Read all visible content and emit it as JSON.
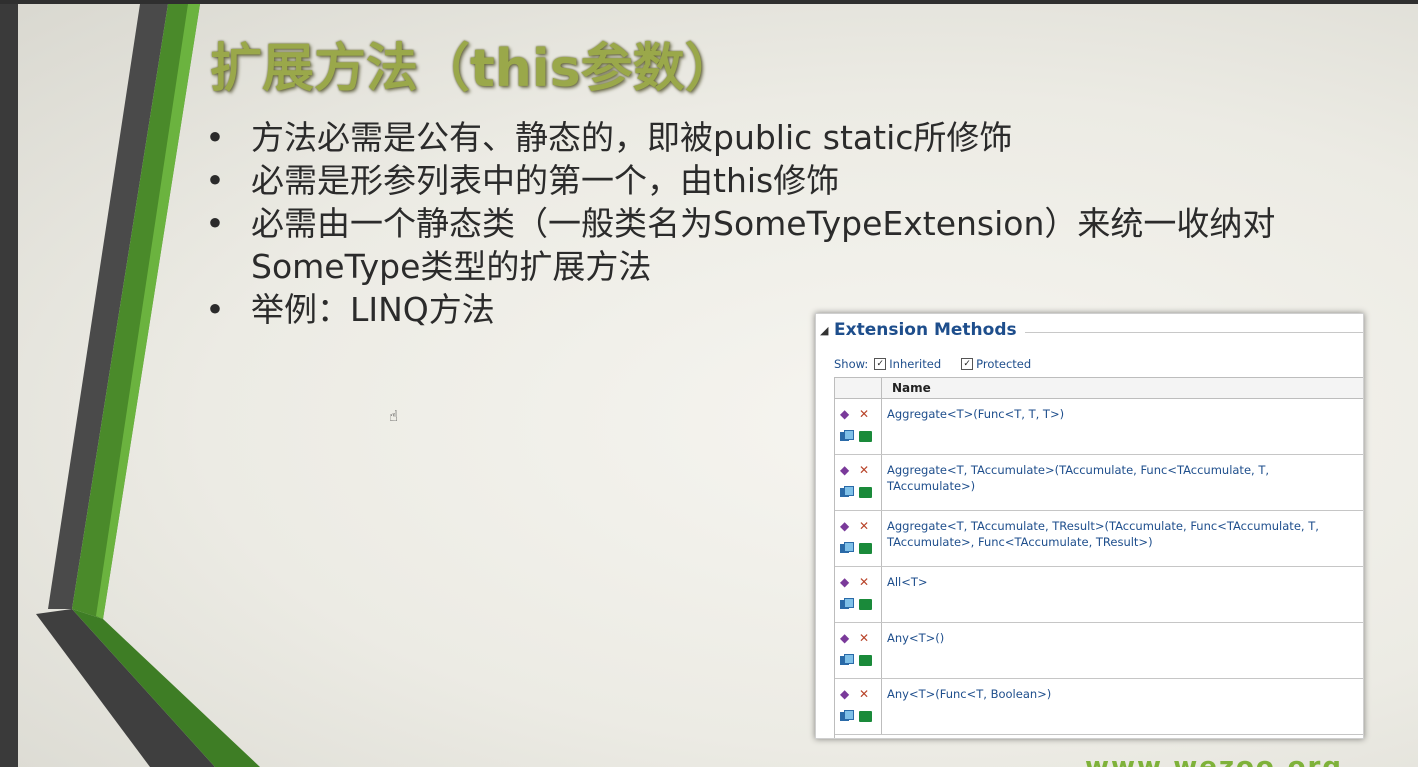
{
  "slide": {
    "title": "扩展方法（this参数）",
    "bullets": [
      "方法必需是公有、静态的，即被public static所修饰",
      "必需是形参列表中的第一个，由this修饰",
      "必需由一个静态类（一般类名为SomeTypeExtension）来统一收纳对SomeType类型的扩展方法",
      "举例：LINQ方法"
    ],
    "bullet_glyph": "•",
    "footer_logo": "www.wezoo.org"
  },
  "panel": {
    "title": "Extension Methods",
    "collapse_glyph": "◢",
    "show_label": "Show:",
    "filters": [
      {
        "label": "Inherited",
        "checked": true
      },
      {
        "label": "Protected",
        "checked": true
      }
    ],
    "check_glyph": "✓",
    "column_name": "Name",
    "rows": [
      "Aggregate<T>(Func<T, T, T>)",
      "Aggregate<T, TAccumulate>(TAccumulate, Func<TAccumulate, T, TAccumulate>)",
      "Aggregate<T, TAccumulate, TResult>(TAccumulate, Func<TAccumulate, T, TAccumulate>, Func<TAccumulate, TResult>)",
      "All<T>",
      "Any<T>()",
      "Any<T>(Func<T, Boolean>)"
    ],
    "row_icons": [
      "extension-method-icon",
      "static-icon",
      "public-method-icon",
      "assembly-icon"
    ],
    "icon_glyphs": {
      "ext": "◆",
      "x": "✕"
    }
  },
  "cursor_glyph": "☝",
  "colors": {
    "title": "#9aa84a",
    "link_blue": "#1e4e8c",
    "stripe_green": "#4a8a2a",
    "stripe_gray": "#4a4a4a"
  }
}
